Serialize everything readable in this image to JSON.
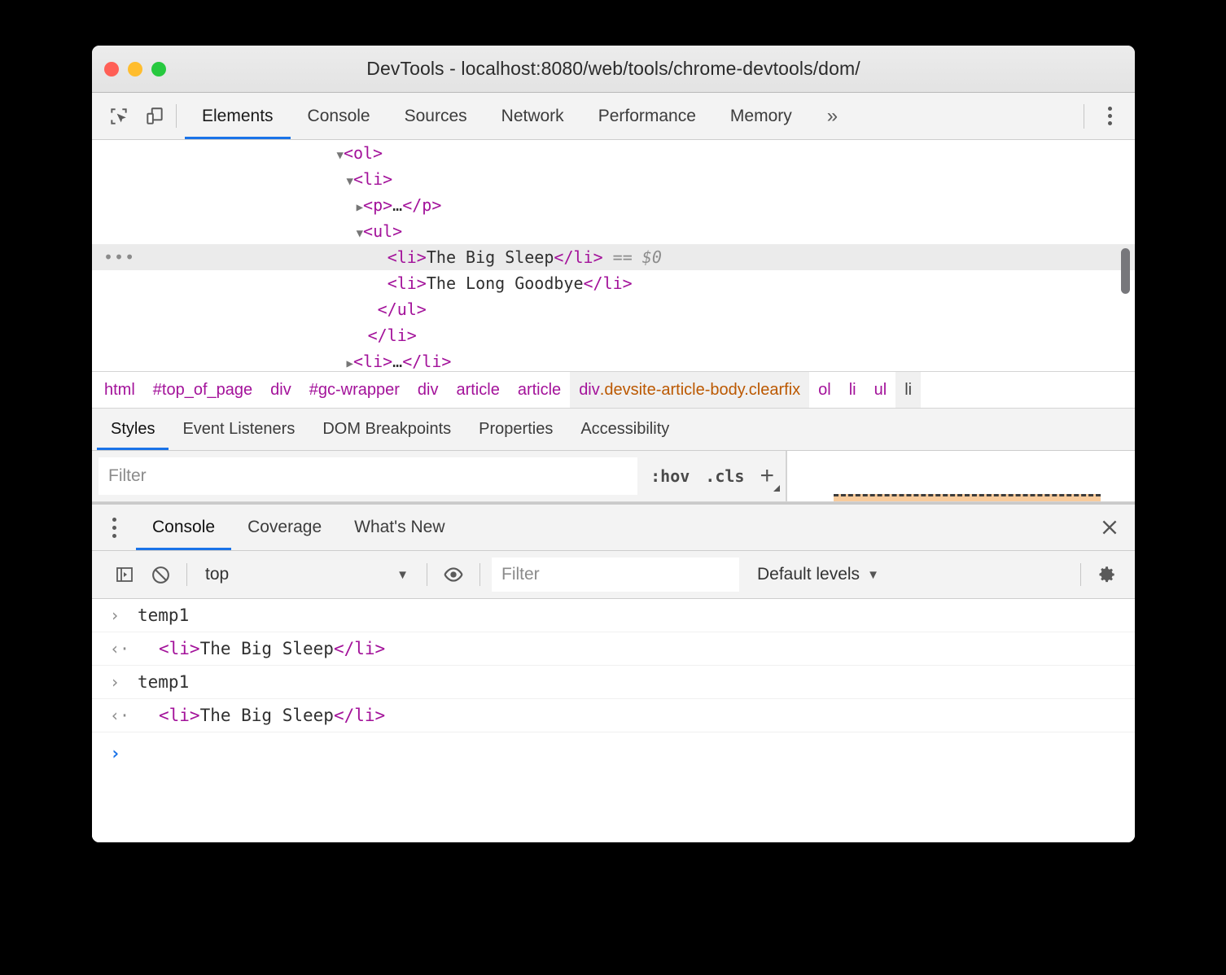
{
  "window": {
    "title": "DevTools - localhost:8080/web/tools/chrome-devtools/dom/",
    "traffic_lights": [
      "close",
      "minimize",
      "zoom"
    ]
  },
  "main_toolbar": {
    "icons": [
      {
        "name": "inspect-element-icon",
        "label": "inspect"
      },
      {
        "name": "device-toolbar-icon",
        "label": "device"
      }
    ],
    "tabs": [
      {
        "label": "Elements",
        "active": true
      },
      {
        "label": "Console",
        "active": false
      },
      {
        "label": "Sources",
        "active": false
      },
      {
        "label": "Network",
        "active": false
      },
      {
        "label": "Performance",
        "active": false
      },
      {
        "label": "Memory",
        "active": false
      }
    ],
    "more_tabs_label": "»",
    "menu_label": "Customize and control DevTools"
  },
  "dom_tree": {
    "rows": [
      {
        "indent": 10,
        "twisty": "▼",
        "parts": [
          {
            "t": "tag",
            "v": "<ol>"
          }
        ],
        "selected": false
      },
      {
        "indent": 11,
        "twisty": "▼",
        "parts": [
          {
            "t": "tag",
            "v": "<li>"
          }
        ],
        "selected": false
      },
      {
        "indent": 12,
        "twisty": "▶",
        "parts": [
          {
            "t": "tag",
            "v": "<p>"
          },
          {
            "t": "txt",
            "v": "…"
          },
          {
            "t": "tag",
            "v": "</p>"
          }
        ],
        "selected": false
      },
      {
        "indent": 12,
        "twisty": "▼",
        "parts": [
          {
            "t": "tag",
            "v": "<ul>"
          }
        ],
        "selected": false
      },
      {
        "indent": 14,
        "twisty": "",
        "parts": [
          {
            "t": "tag",
            "v": "<li>"
          },
          {
            "t": "txt",
            "v": "The Big Sleep"
          },
          {
            "t": "tag",
            "v": "</li>"
          },
          {
            "t": "txt",
            "v": " "
          },
          {
            "t": "eq",
            "v": "== "
          },
          {
            "t": "dollar",
            "v": "$0"
          }
        ],
        "selected": true
      },
      {
        "indent": 14,
        "twisty": "",
        "parts": [
          {
            "t": "tag",
            "v": "<li>"
          },
          {
            "t": "txt",
            "v": "The Long Goodbye"
          },
          {
            "t": "tag",
            "v": "</li>"
          }
        ],
        "selected": false
      },
      {
        "indent": 13,
        "twisty": "",
        "parts": [
          {
            "t": "tag",
            "v": "</ul>"
          }
        ],
        "selected": false
      },
      {
        "indent": 12,
        "twisty": "",
        "parts": [
          {
            "t": "tag",
            "v": "</li>"
          }
        ],
        "selected": false
      },
      {
        "indent": 11,
        "twisty": "▶",
        "parts": [
          {
            "t": "tag",
            "v": "<li>"
          },
          {
            "t": "txt",
            "v": "…"
          },
          {
            "t": "tag",
            "v": "</li>"
          }
        ],
        "selected": false
      }
    ],
    "selected_row_marker": "•••"
  },
  "breadcrumb": {
    "items": [
      {
        "label": "html",
        "type": "tag",
        "state": "normal"
      },
      {
        "label": "#top_of_page",
        "type": "id",
        "state": "normal"
      },
      {
        "label": "div",
        "type": "tag",
        "state": "normal"
      },
      {
        "label": "#gc-wrapper",
        "type": "id",
        "state": "normal"
      },
      {
        "label": "div",
        "type": "tag",
        "state": "normal"
      },
      {
        "label": "article",
        "type": "tag",
        "state": "normal"
      },
      {
        "label": "article",
        "type": "tag",
        "state": "normal"
      },
      {
        "label": "div.devsite-article-body.clearfix",
        "tag_part": "div",
        "cls_part": ".devsite-article-body.clearfix",
        "type": "tag-class",
        "state": "hover"
      },
      {
        "label": "ol",
        "type": "tag",
        "state": "normal"
      },
      {
        "label": "li",
        "type": "tag",
        "state": "normal"
      },
      {
        "label": "ul",
        "type": "tag",
        "state": "normal"
      },
      {
        "label": "li",
        "type": "tag",
        "state": "current"
      }
    ]
  },
  "sidebar_tabs": [
    {
      "label": "Styles",
      "active": true
    },
    {
      "label": "Event Listeners",
      "active": false
    },
    {
      "label": "DOM Breakpoints",
      "active": false
    },
    {
      "label": "Properties",
      "active": false
    },
    {
      "label": "Accessibility",
      "active": false
    }
  ],
  "styles_pane": {
    "filter_placeholder": "Filter",
    "filter_value": "",
    "hov_label": ":hov",
    "cls_label": ".cls",
    "new_rule_label": "+"
  },
  "drawer": {
    "menu_label": "More tools",
    "tabs": [
      {
        "label": "Console",
        "active": true
      },
      {
        "label": "Coverage",
        "active": false
      },
      {
        "label": "What's New",
        "active": false
      }
    ],
    "close_label": "×",
    "toolbar": {
      "sidebar_toggle_name": "console-sidebar-toggle",
      "clear_label": "Clear console",
      "context_value": "top",
      "context_caret": "▼",
      "eye_label": "Create live expression",
      "filter_placeholder": "Filter",
      "filter_value": "",
      "levels_label": "Default levels",
      "levels_caret": "▼",
      "settings_label": "Console settings"
    },
    "messages": [
      {
        "kind": "input",
        "gutter": "›",
        "text": "temp1"
      },
      {
        "kind": "result",
        "gutter": "‹·",
        "segments": [
          {
            "t": "tag",
            "v": "<li>"
          },
          {
            "t": "txt",
            "v": "The Big Sleep"
          },
          {
            "t": "tag",
            "v": "</li>"
          }
        ]
      },
      {
        "kind": "input",
        "gutter": "›",
        "text": "temp1"
      },
      {
        "kind": "result",
        "gutter": "‹·",
        "segments": [
          {
            "t": "tag",
            "v": "<li>"
          },
          {
            "t": "txt",
            "v": "The Big Sleep"
          },
          {
            "t": "tag",
            "v": "</li>"
          }
        ]
      }
    ],
    "prompt": {
      "gutter": "›",
      "value": ""
    }
  },
  "colors": {
    "accent": "#1a73e8",
    "tag": "#a3129a",
    "class": "#bb5800",
    "selected_row_bg": "#ebebeb",
    "chrome_bg": "#f3f3f3",
    "box_model_margin": "#f8cb9c"
  }
}
